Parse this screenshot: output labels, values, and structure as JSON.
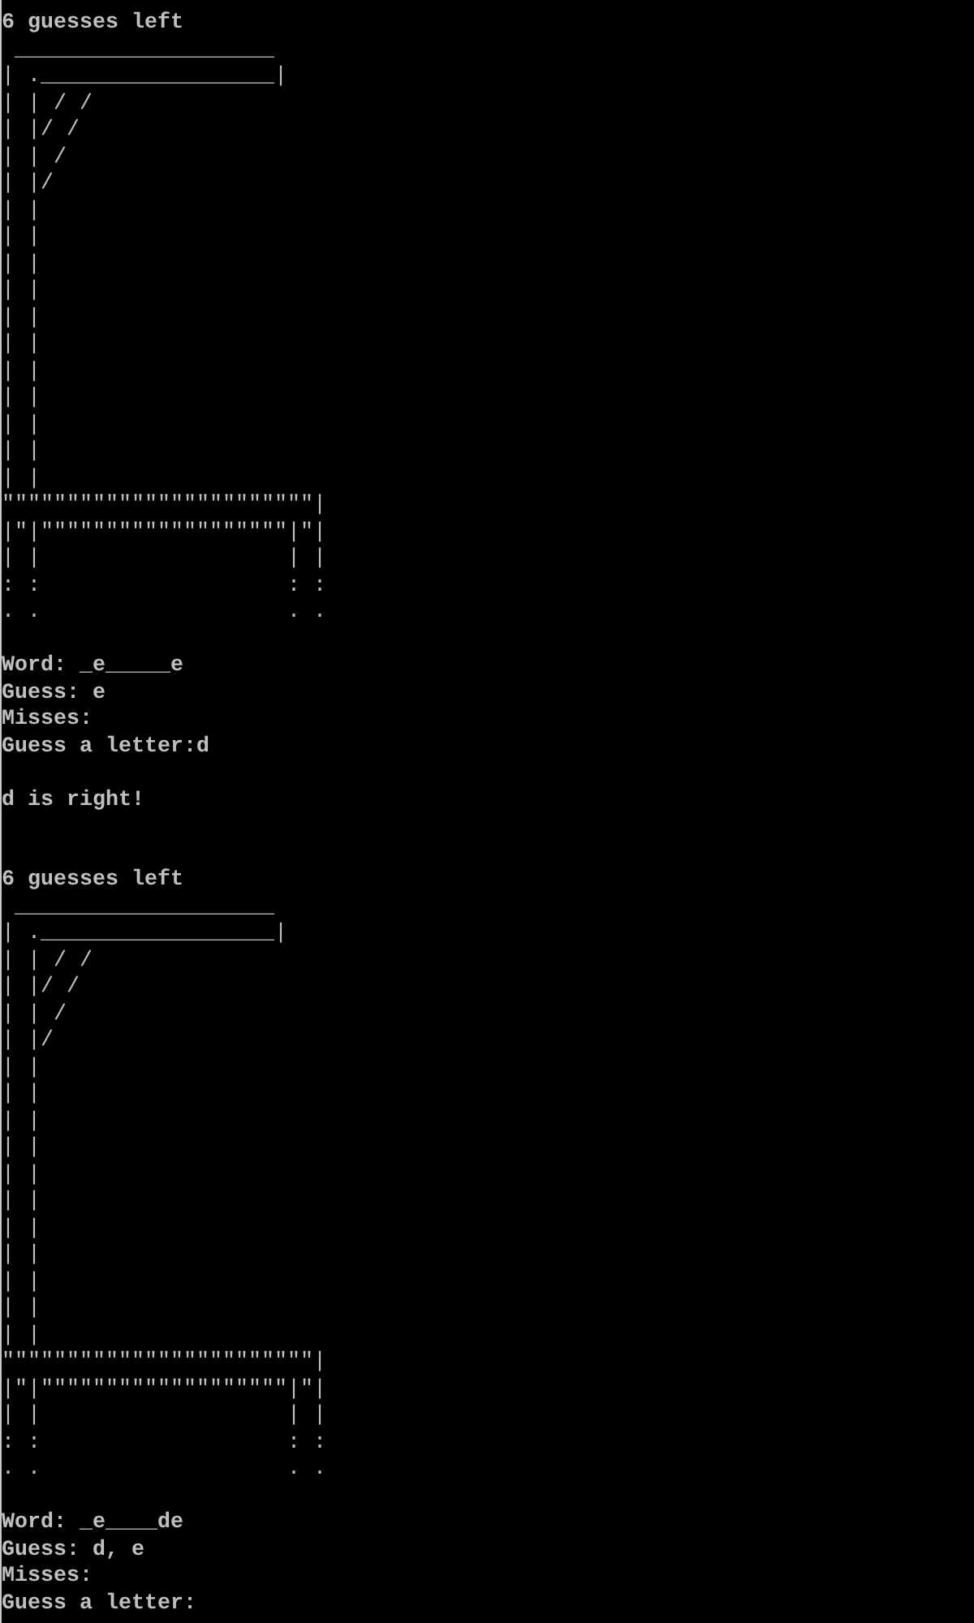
{
  "console": {
    "lines": [
      {
        "kind": "text",
        "text": "6 guesses left"
      },
      {
        "kind": "art",
        "lines": [
          " ____________________",
          "| .__________________|",
          "| | / /",
          "| |/ /",
          "| | /",
          "| |/",
          "| |",
          "| |",
          "| |",
          "| |",
          "| |",
          "| |",
          "| |",
          "| |",
          "| |",
          "| |",
          "| |",
          "\"\"\"\"\"\"\"\"\"\"\"\"\"\"\"\"\"\"\"\"\"\"\"\"|",
          "|\"|\"\"\"\"\"\"\"\"\"\"\"\"\"\"\"\"\"\"\"|\"|",
          "| |                   | |",
          ": :                   : :",
          ". .                   . ."
        ]
      },
      {
        "kind": "blank"
      },
      {
        "kind": "text",
        "text": "Word: _e_____e"
      },
      {
        "kind": "text",
        "text": "Guess: e"
      },
      {
        "kind": "text",
        "text": "Misses:"
      },
      {
        "kind": "text",
        "text": "Guess a letter:d"
      },
      {
        "kind": "blank"
      },
      {
        "kind": "text",
        "text": "d is right!"
      },
      {
        "kind": "blank"
      },
      {
        "kind": "blank"
      },
      {
        "kind": "text",
        "text": "6 guesses left"
      },
      {
        "kind": "art",
        "lines": [
          " ____________________",
          "| .__________________|",
          "| | / /",
          "| |/ /",
          "| | /",
          "| |/",
          "| |",
          "| |",
          "| |",
          "| |",
          "| |",
          "| |",
          "| |",
          "| |",
          "| |",
          "| |",
          "| |",
          "\"\"\"\"\"\"\"\"\"\"\"\"\"\"\"\"\"\"\"\"\"\"\"\"|",
          "|\"|\"\"\"\"\"\"\"\"\"\"\"\"\"\"\"\"\"\"\"|\"|",
          "| |                   | |",
          ": :                   : :",
          ". .                   . ."
        ]
      },
      {
        "kind": "blank"
      },
      {
        "kind": "text",
        "text": "Word: _e____de"
      },
      {
        "kind": "text",
        "text": "Guess: d, e"
      },
      {
        "kind": "text",
        "text": "Misses:"
      },
      {
        "kind": "text",
        "text": "Guess a letter:"
      }
    ]
  }
}
